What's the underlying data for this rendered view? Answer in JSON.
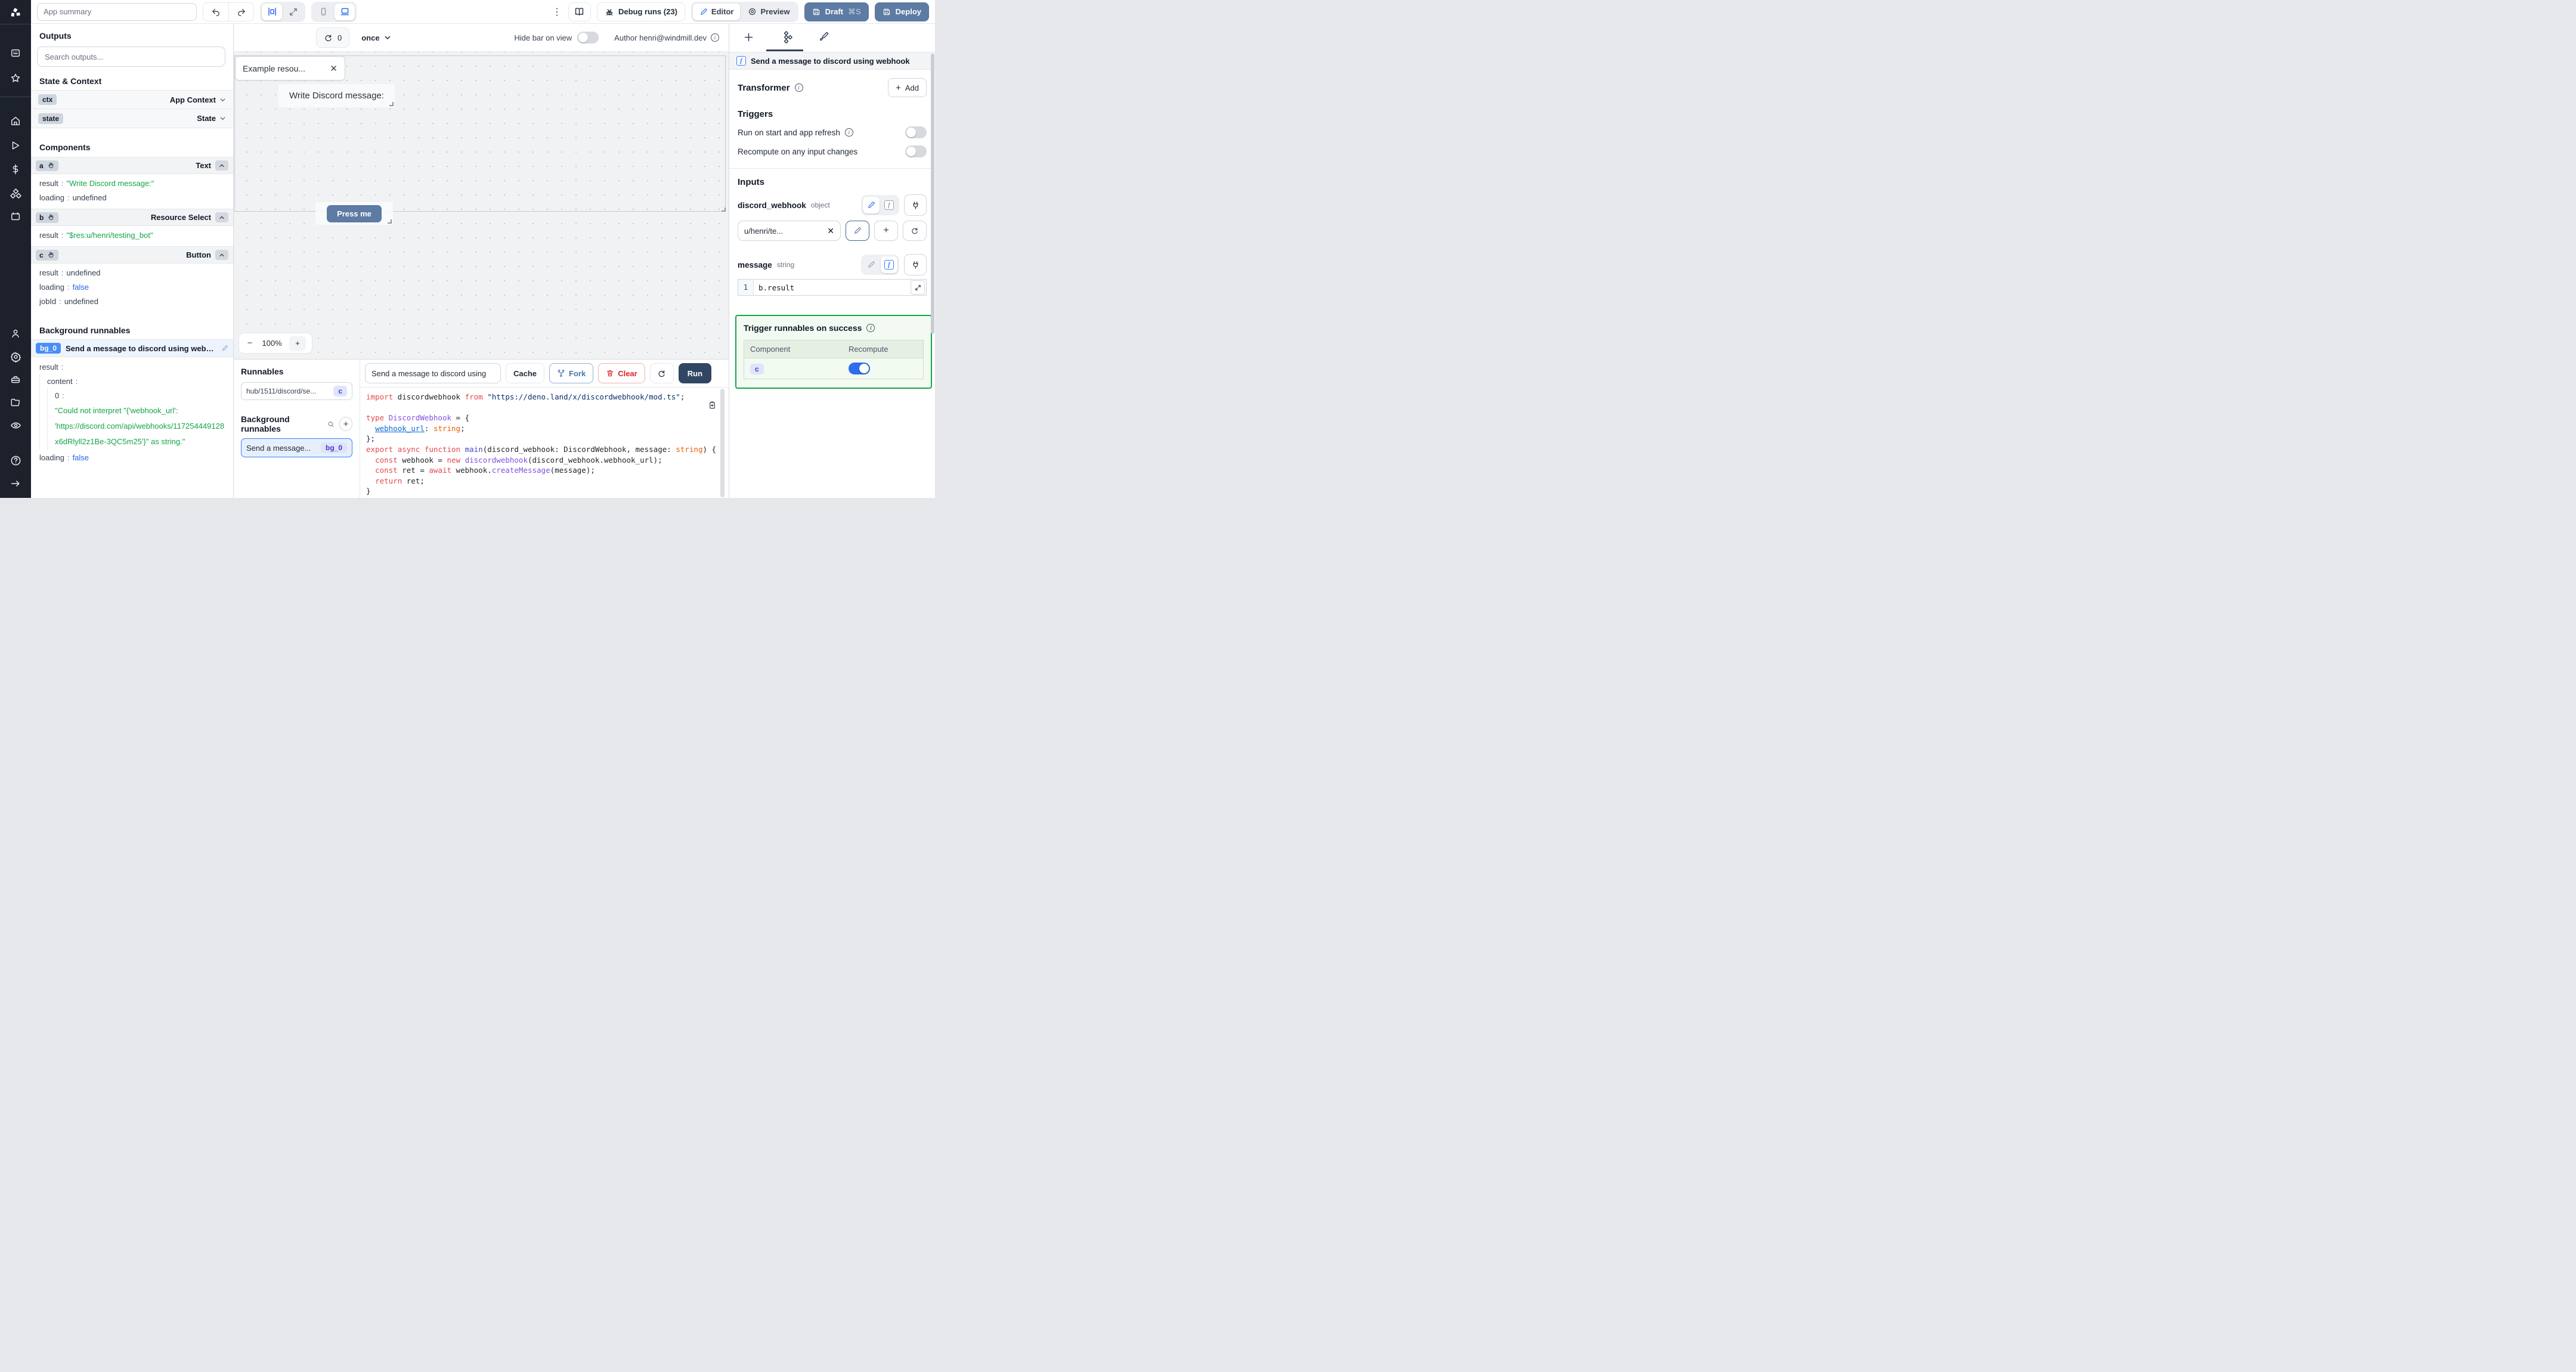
{
  "colors": {
    "accent_blue": "#2f6bed",
    "slate_button": "#5d7ba3",
    "run_button": "#314663",
    "success_green": "#17a34a",
    "result_green": "#16a34a",
    "link_blue": "#2563eb",
    "badge_indigo_bg": "#dfe4fb",
    "badge_indigo_text": "#4338ca",
    "rail_bg": "#1c212c"
  },
  "topbar": {
    "app_summary_placeholder": "App summary",
    "debug_runs": "Debug runs (23)",
    "editor": "Editor",
    "preview": "Preview",
    "draft": "Draft",
    "draft_shortcut": "⌘S",
    "deploy": "Deploy"
  },
  "canvas_bar": {
    "refresh_count": "0",
    "mode": "once",
    "hide_bar_label": "Hide bar on view",
    "author": "Author henri@windmill.dev"
  },
  "canvas": {
    "text_component": "Write Discord message:",
    "select_value": "Example resou...",
    "button_label": "Press me",
    "zoom_value": "100%",
    "zoom_minus": "−",
    "zoom_plus": "+"
  },
  "outputs": {
    "title": "Outputs",
    "search_placeholder": "Search outputs...",
    "state_context_title": "State & Context",
    "ctx": {
      "badge": "ctx",
      "label": "App Context"
    },
    "state": {
      "badge": "state",
      "label": "State"
    },
    "components_title": "Components",
    "comp_a": {
      "badge": "a",
      "type": "Text",
      "rows": [
        {
          "k": "result",
          "v": "\"Write Discord message:\""
        },
        {
          "k": "loading",
          "v": "undefined"
        }
      ]
    },
    "comp_b": {
      "badge": "b",
      "type": "Resource Select",
      "rows": [
        {
          "k": "result",
          "v": "\"$res:u/henri/testing_bot\""
        }
      ]
    },
    "comp_c": {
      "badge": "c",
      "type": "Button",
      "rows": [
        {
          "k": "result",
          "v": "undefined"
        },
        {
          "k": "loading",
          "v": "false"
        },
        {
          "k": "jobId",
          "v": "undefined"
        }
      ]
    },
    "bg_title": "Background runnables",
    "bg0": {
      "badge": "bg_0",
      "label": "Send a message to discord using webhook",
      "result_key": "result",
      "content_key": "content",
      "zero_key": "0",
      "error_lines": [
        "\"Could not interpret \"{'webhook_url':",
        "'https://discord.com/api/webhooks/117254449128",
        "x6dRlyll2z1Be-3QC5m25'}\" as string.\""
      ],
      "loading_key": "loading",
      "loading_val": "false"
    }
  },
  "runnables": {
    "title": "Runnables",
    "item_label": "hub/1511/discord/se...",
    "item_badge": "c",
    "bg_title": "Background runnables",
    "bg_item_label": "Send a message...",
    "bg_item_badge": "bg_0"
  },
  "editor": {
    "name": "Send a message to discord using",
    "cache": "Cache",
    "fork": "Fork",
    "clear": "Clear",
    "run": "Run"
  },
  "code": {
    "lines": [
      [
        [
          "k",
          "import"
        ],
        [
          "p",
          " discordwebhook "
        ],
        [
          "k",
          "from"
        ],
        [
          "s",
          " \"https://deno.land/x/discordwebhook/mod.ts\""
        ],
        [
          "p",
          ";"
        ]
      ],
      [],
      [
        [
          "k",
          "type"
        ],
        [
          "p",
          " "
        ],
        [
          "ty",
          "DiscordWebhook"
        ],
        [
          "p",
          " = {"
        ]
      ],
      [
        [
          "p",
          "  "
        ],
        [
          "pr",
          "webhook_url"
        ],
        [
          "p",
          ": "
        ],
        [
          "o",
          "string"
        ],
        [
          "p",
          ";"
        ]
      ],
      [
        [
          "p",
          "};"
        ]
      ],
      [
        [
          "k",
          "export"
        ],
        [
          "p",
          " "
        ],
        [
          "k",
          "async"
        ],
        [
          "p",
          " "
        ],
        [
          "k",
          "function"
        ],
        [
          "p",
          " "
        ],
        [
          "fn",
          "main"
        ],
        [
          "p",
          "(discord_webhook: DiscordWebhook, message: "
        ],
        [
          "o",
          "string"
        ],
        [
          "p",
          ") {"
        ]
      ],
      [
        [
          "p",
          "  "
        ],
        [
          "k",
          "const"
        ],
        [
          "p",
          " webhook = "
        ],
        [
          "k",
          "new"
        ],
        [
          "p",
          " "
        ],
        [
          "ty",
          "discordwebhook"
        ],
        [
          "p",
          "(discord_webhook.webhook_url);"
        ]
      ],
      [
        [
          "p",
          "  "
        ],
        [
          "k",
          "const"
        ],
        [
          "p",
          " ret = "
        ],
        [
          "k",
          "await"
        ],
        [
          "p",
          " webhook."
        ],
        [
          "ty",
          "createMessage"
        ],
        [
          "p",
          "(message);"
        ]
      ],
      [
        [
          "p",
          "  "
        ],
        [
          "k",
          "return"
        ],
        [
          "p",
          " ret;"
        ]
      ],
      [
        [
          "p",
          "}"
        ]
      ]
    ]
  },
  "right": {
    "header": "Send a message to discord using webhook",
    "transformer": "Transformer",
    "add": "Add",
    "triggers": "Triggers",
    "run_on_start": "Run on start and app refresh",
    "recompute": "Recompute on any input changes",
    "inputs_title": "Inputs",
    "discord_webhook": {
      "name": "discord_webhook",
      "type": "object",
      "value": "u/henri/te..."
    },
    "message": {
      "name": "message",
      "type": "string",
      "line_no": "1",
      "value": "b.result"
    },
    "success": {
      "title": "Trigger runnables on success",
      "col_component": "Component",
      "col_recompute": "Recompute",
      "row_badge": "c"
    }
  }
}
